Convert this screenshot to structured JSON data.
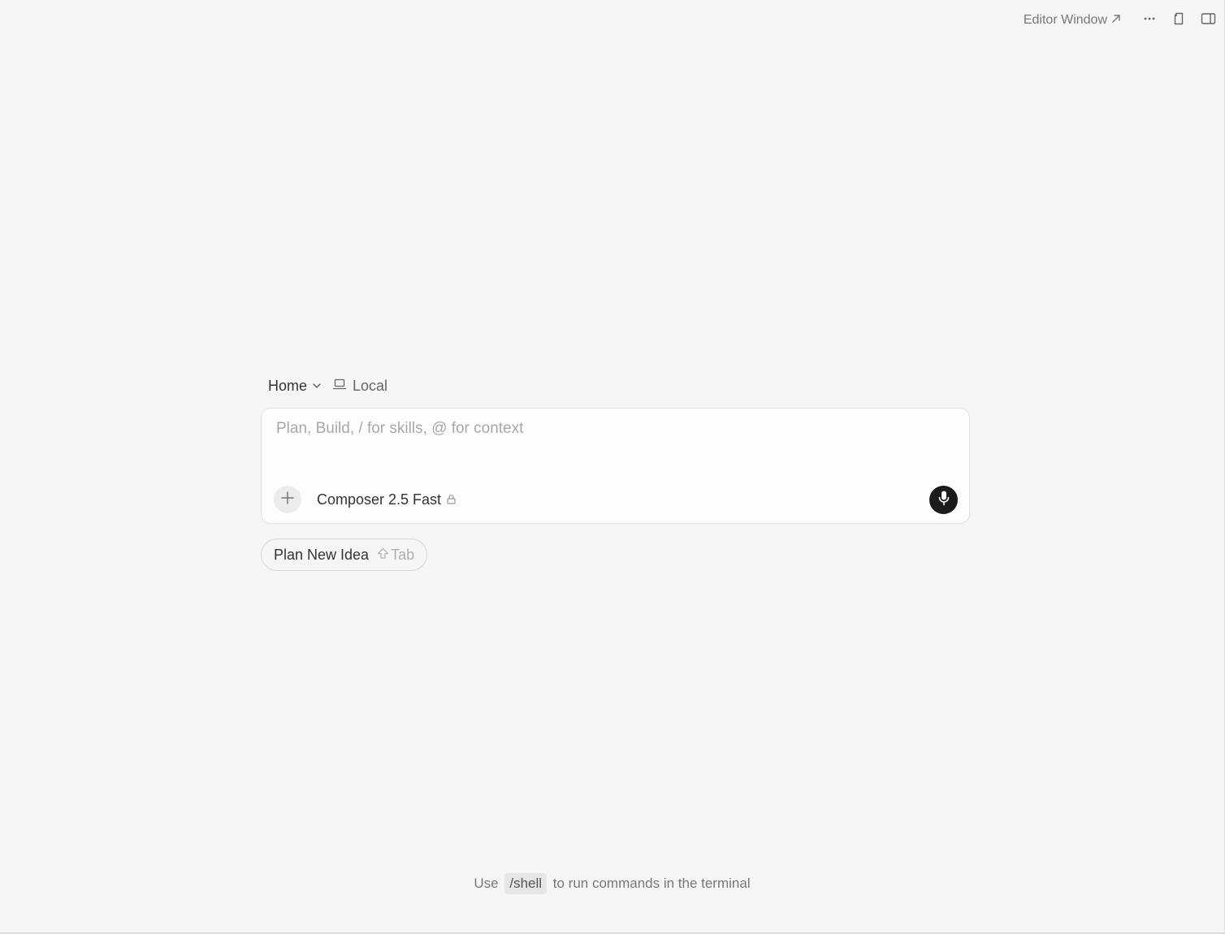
{
  "topbar": {
    "editor_window_label": "Editor Window",
    "icons": [
      "arrow-up-right-icon",
      "more-icon",
      "page-icon",
      "sidebar-toggle-icon"
    ]
  },
  "composer": {
    "workspace_label": "Home",
    "location_label": "Local",
    "input": {
      "value": "",
      "placeholder": "Plan, Build, / for skills, @ for context"
    },
    "model_label": "Composer 2.5 Fast",
    "icons": [
      "chevron-down-icon",
      "laptop-icon",
      "plus-icon",
      "lock-icon",
      "microphone-icon"
    ]
  },
  "suggestion": {
    "label": "Plan New Idea",
    "shortcut": "Tab",
    "shortcut_icon": "shift-icon"
  },
  "footer": {
    "prefix": "Use",
    "command": "/shell",
    "suffix": "to run commands in the terminal"
  },
  "colors": {
    "background": "#f6f6f6",
    "card": "#fdfdfd",
    "mic_button": "#1b1b1b",
    "muted_text": "#777777"
  }
}
